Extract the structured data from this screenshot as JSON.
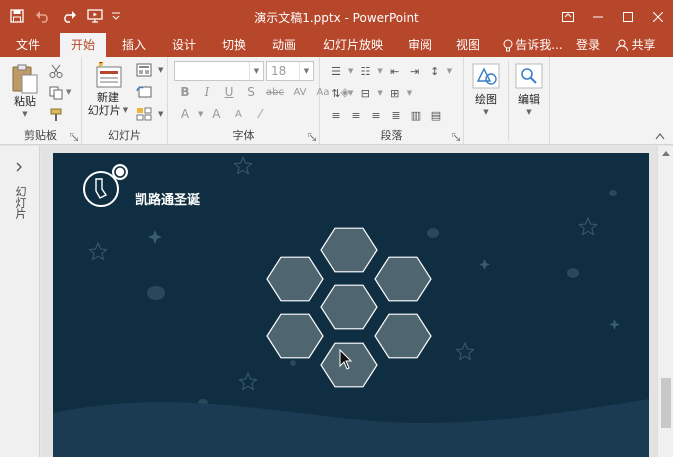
{
  "window": {
    "title": "演示文稿1.pptx - PowerPoint"
  },
  "tabs": [
    {
      "label": "文件"
    },
    {
      "label": "开始"
    },
    {
      "label": "插入"
    },
    {
      "label": "设计"
    },
    {
      "label": "切换"
    },
    {
      "label": "动画"
    },
    {
      "label": "幻灯片放映"
    },
    {
      "label": "审阅"
    },
    {
      "label": "视图"
    }
  ],
  "tellme": {
    "label": "告诉我..."
  },
  "account": {
    "signin": "登录",
    "share": "共享"
  },
  "ribbon": {
    "clipboard": {
      "label": "剪贴板",
      "paste": "粘贴"
    },
    "slides": {
      "label": "幻灯片",
      "new_slide_line1": "新建",
      "new_slide_line2": "幻灯片"
    },
    "font": {
      "label": "字体",
      "size": "18"
    },
    "paragraph": {
      "label": "段落"
    },
    "drawing": {
      "label": "绘图"
    },
    "editing": {
      "label": "编辑"
    }
  },
  "thumbnails": {
    "label": "幻灯片"
  },
  "slide": {
    "title": "凯路通圣诞",
    "background_color": "#0f2e42",
    "hex_fill": "#5b7078",
    "hex_stroke": "#ffffff"
  },
  "colors": {
    "accent": "#b7472a",
    "ribbon_bg": "#f3f3f3"
  }
}
